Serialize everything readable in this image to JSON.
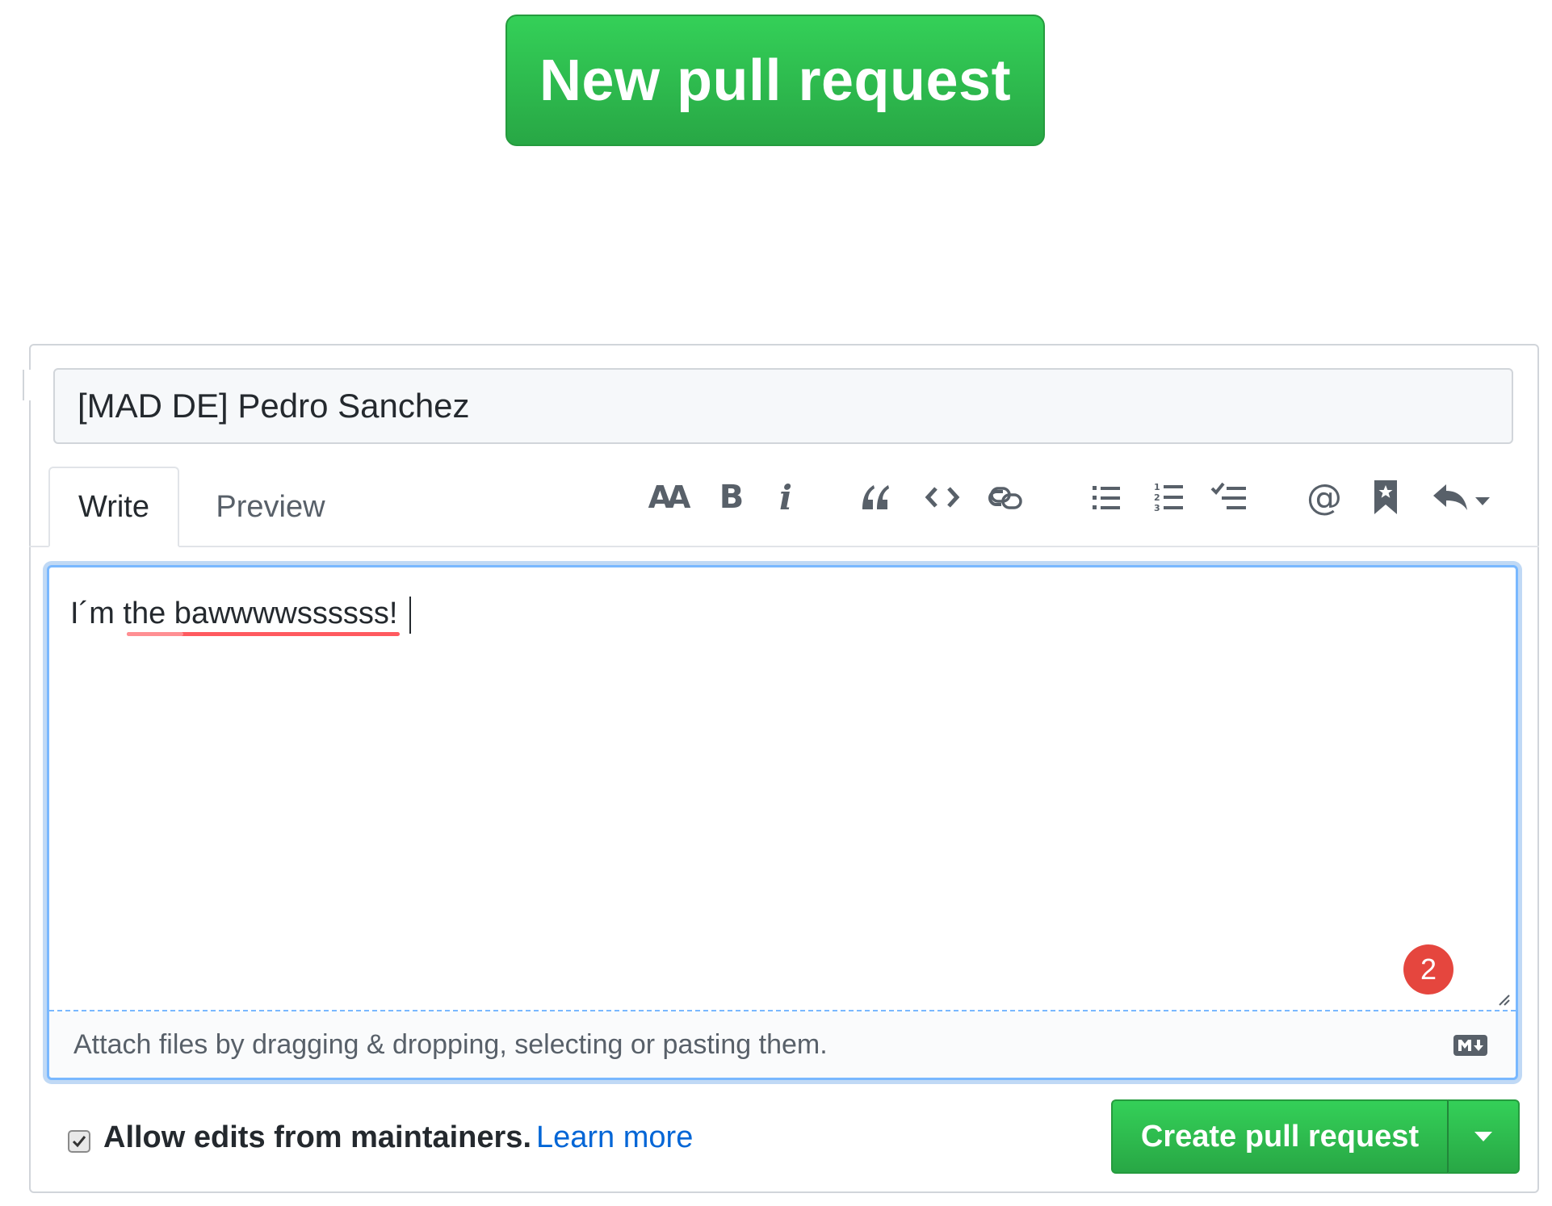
{
  "top_button": {
    "label": "New pull request"
  },
  "pr_form": {
    "title_value": "[MAD DE] Pedro Sanchez",
    "tabs": [
      {
        "label": "Write",
        "active": true
      },
      {
        "label": "Preview",
        "active": false
      }
    ],
    "toolbar": [
      {
        "icon": "text-size-icon",
        "glyph": "AA"
      },
      {
        "icon": "bold-icon",
        "glyph": "B"
      },
      {
        "icon": "italic-icon",
        "glyph": "i"
      },
      {
        "icon": "quote-icon"
      },
      {
        "icon": "code-icon"
      },
      {
        "icon": "link-icon"
      },
      {
        "icon": "unordered-list-icon"
      },
      {
        "icon": "ordered-list-icon"
      },
      {
        "icon": "task-list-icon"
      },
      {
        "icon": "mention-icon",
        "glyph": "@"
      },
      {
        "icon": "bookmark-icon"
      },
      {
        "icon": "reply-icon"
      }
    ],
    "body_value": "I´m the bawwwwssssss!",
    "attach_hint": "Attach files by dragging & dropping, selecting or pasting them.",
    "notification_badge": "2",
    "allow_edits_label": "Allow edits from maintainers.",
    "allow_edits_checked": true,
    "learn_more_label": "Learn more",
    "submit_label": "Create pull request"
  },
  "colors": {
    "green": "#28a745",
    "link_blue": "#0366d6",
    "focus_blue": "#79b8ff",
    "badge_red": "#e5463e"
  }
}
